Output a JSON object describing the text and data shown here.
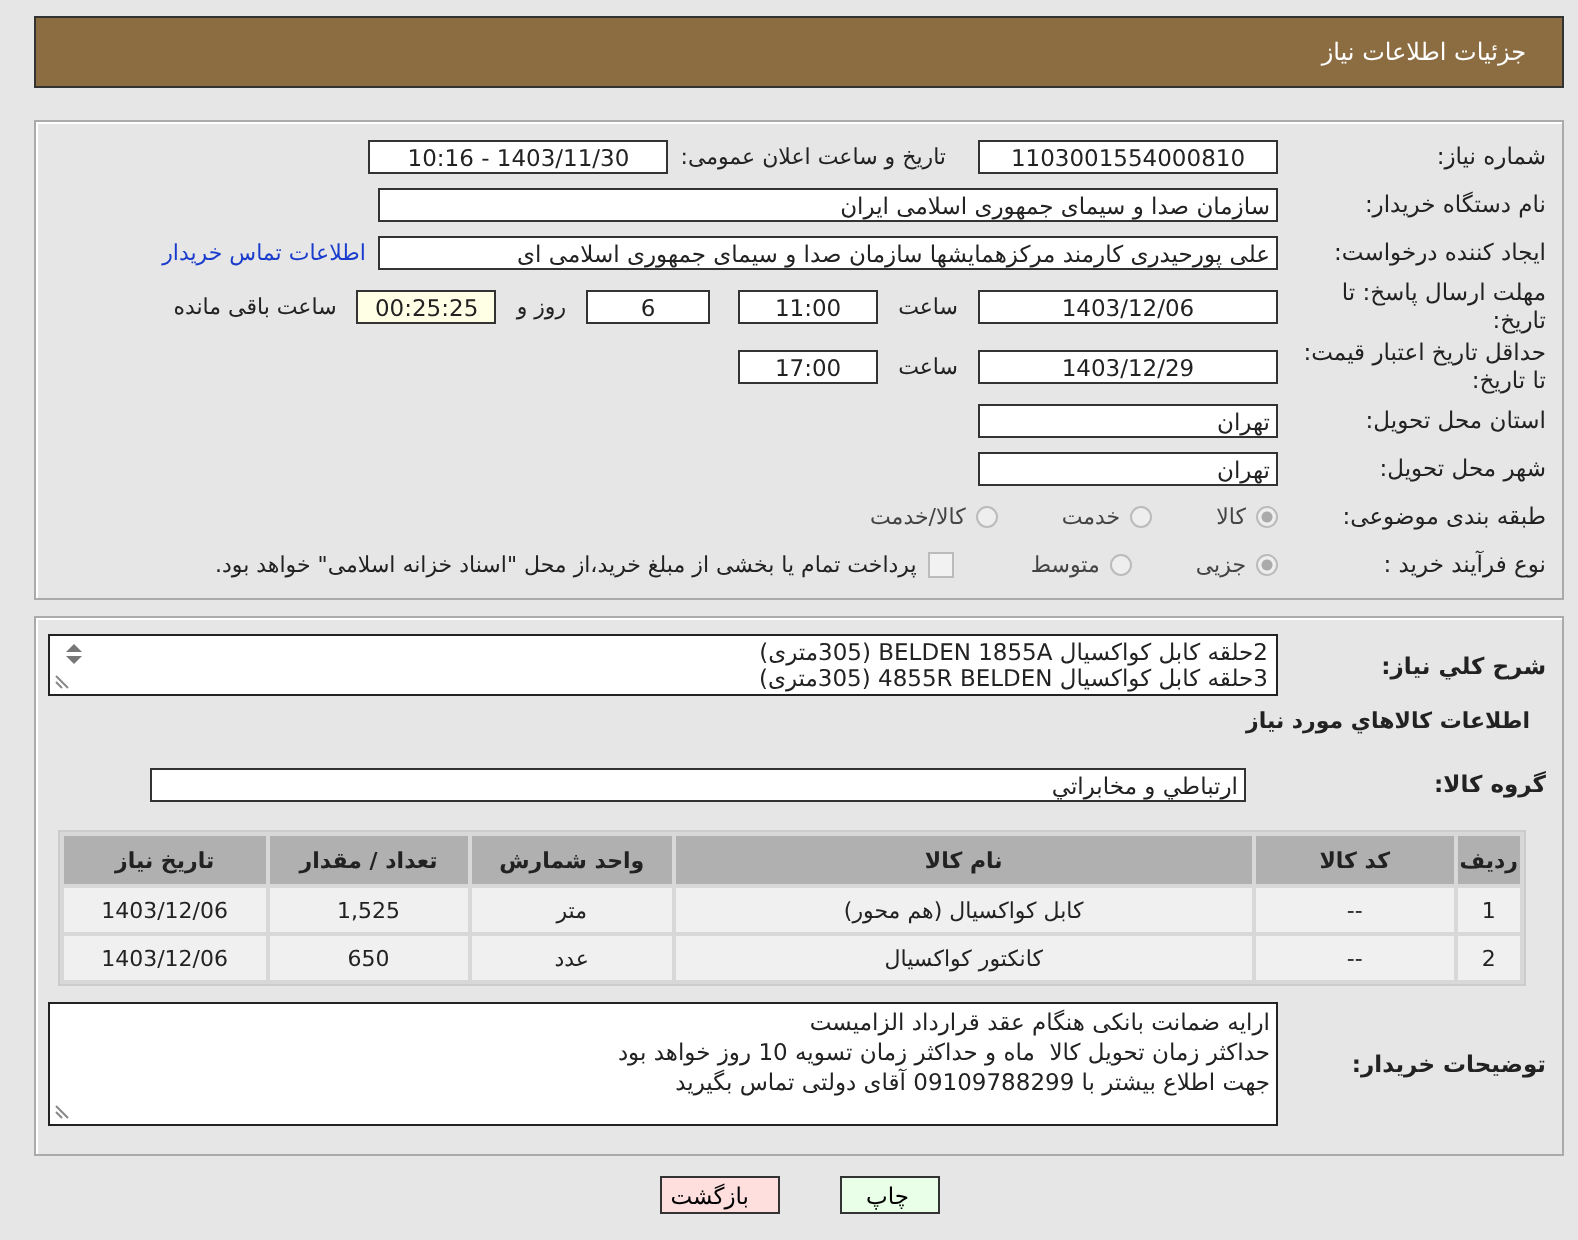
{
  "header": {
    "title": "جزئیات اطلاعات نیاز"
  },
  "need_number": {
    "label": "شماره نیاز:",
    "value": "1103001554000810"
  },
  "announce": {
    "label": "تاریخ و ساعت اعلان عمومی:",
    "value": "1403/11/30 - 10:16"
  },
  "buyer": {
    "label": "نام دستگاه خریدار:",
    "value": "سازمان صدا و سیمای جمهوری اسلامی ایران"
  },
  "requester": {
    "label": "ایجاد کننده درخواست:",
    "value": "علی پورحیدری کارمند مرکزهمایشها سازمان صدا و سیمای جمهوری اسلامی ای",
    "link": "اطلاعات تماس خریدار"
  },
  "reply_deadline": {
    "label": "مهلت ارسال پاسخ: تا تاریخ:",
    "date": "1403/12/06",
    "time_label": "ساعت",
    "time": "11:00",
    "days": "6",
    "days_label": "روز و",
    "remaining": "00:25:25",
    "remaining_label": "ساعت باقی مانده"
  },
  "price_validity": {
    "label": "حداقل تاریخ اعتبار قیمت: تا تاریخ:",
    "date": "1403/12/29",
    "time_label": "ساعت",
    "time": "17:00"
  },
  "province": {
    "label": "استان محل تحویل:",
    "value": "تهران"
  },
  "city": {
    "label": "شهر محل تحویل:",
    "value": "تهران"
  },
  "category": {
    "label": "طبقه بندی موضوعی:",
    "options": [
      {
        "label": "کالا",
        "selected": true
      },
      {
        "label": "خدمت",
        "selected": false
      },
      {
        "label": "کالا/خدمت",
        "selected": false
      }
    ]
  },
  "process": {
    "label": "نوع فرآیند خرید :",
    "options": [
      {
        "label": "جزیی",
        "selected": true
      },
      {
        "label": "متوسط",
        "selected": false
      }
    ],
    "payment": {
      "checked": false,
      "label": "پرداخت تمام یا بخشی از مبلغ خرید،از محل \"اسناد خزانه اسلامی\" خواهد بود."
    }
  },
  "description": {
    "label": "شرح کلي نياز:",
    "lines": [
      "2حلقه کابل کواکسیال BELDEN 1855A (305متری)",
      "3حلقه کابل کواکسیال 4855R BELDEN (305متری)"
    ]
  },
  "goods_title": "اطلاعات کالاهاي مورد نياز",
  "goods_group": {
    "label": "گروه کالا:",
    "value": "ارتباطي و مخابراتي"
  },
  "table": {
    "columns": [
      "ردیف",
      "کد کالا",
      "نام کالا",
      "واحد شمارش",
      "تعداد / مقدار",
      "تاریخ نیاز"
    ],
    "rows": [
      [
        "1",
        "--",
        "کابل کواکسیال (هم محور)",
        "متر",
        "1,525",
        "1403/12/06"
      ],
      [
        "2",
        "--",
        "کانکتور کواکسیال",
        "عدد",
        "650",
        "1403/12/06"
      ]
    ]
  },
  "buyer_notes": {
    "label": "توضیحات خریدار:",
    "lines": [
      "ارایه ضمانت بانکی هنگام عقد قرارداد الزامیست",
      "حداکثر زمان تحویل کالا  ماه و حداکثر زمان تسویه 10 روز خواهد بود",
      "جهت اطلاع بیشتر با 09109788299 آقای دولتی تماس بگیرید"
    ]
  },
  "buttons": [
    {
      "label": "چاپ",
      "kind": "print"
    },
    {
      "label": "بازگشت",
      "kind": "back"
    }
  ]
}
